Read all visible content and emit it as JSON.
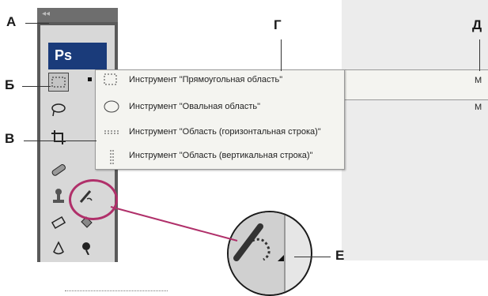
{
  "callouts": {
    "a": "А",
    "b": "Б",
    "v": "В",
    "g": "Г",
    "d": "Д",
    "e": "Е"
  },
  "app": {
    "logo": "Ps"
  },
  "flyout": {
    "items": [
      {
        "label": "Инструмент \"Прямоугольная область\"",
        "shortcut": "M",
        "selected": true,
        "icon": "rect-marquee-icon"
      },
      {
        "label": "Инструмент \"Овальная область\"",
        "shortcut": "M",
        "selected": false,
        "icon": "ellipse-marquee-icon"
      },
      {
        "label": "Инструмент \"Область (горизонтальная строка)\"",
        "shortcut": "",
        "selected": false,
        "icon": "single-row-marquee-icon"
      },
      {
        "label": "Инструмент \"Область (вертикальная строка)\"",
        "shortcut": "",
        "selected": false,
        "icon": "single-column-marquee-icon"
      }
    ]
  },
  "colors": {
    "highlight": "#b0306a",
    "logo_bg": "#1a3b7a"
  }
}
